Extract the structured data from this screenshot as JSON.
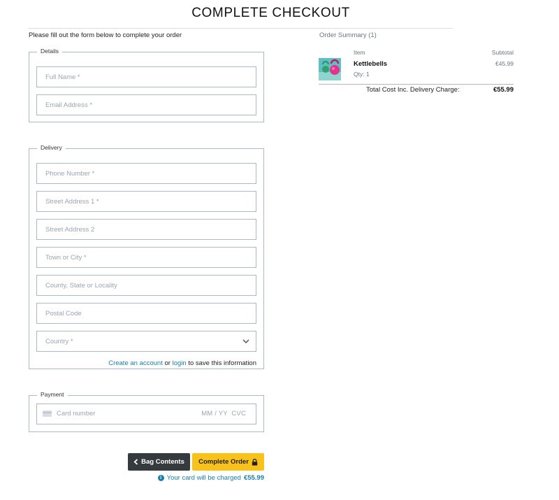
{
  "page": {
    "title": "COMPLETE CHECKOUT",
    "intro": "Please fill out the form below to complete your order"
  },
  "details": {
    "legend": "Details",
    "full_name_placeholder": "Full Name *",
    "email_placeholder": "Email Address *"
  },
  "delivery": {
    "legend": "Delivery",
    "phone_placeholder": "Phone Number *",
    "street1_placeholder": "Street Address 1 *",
    "street2_placeholder": "Street Address 2",
    "town_placeholder": "Town or City *",
    "county_placeholder": "County, State or Locality",
    "postal_placeholder": "Postal Code",
    "country_selected": "Country *",
    "save_note": {
      "create_account": "Create an account",
      "or": "or",
      "login": "login",
      "suffix": "to save this information"
    }
  },
  "payment": {
    "legend": "Payment",
    "card_number_placeholder": "Card number",
    "expiry_cvc_placeholder": "MM / YY  CVC"
  },
  "actions": {
    "back_label": "Bag Contents",
    "complete_label": "Complete Order",
    "charge_note": "Your card will be charged",
    "charge_amount": "€55.99"
  },
  "summary": {
    "title": "Order Summary (1)",
    "col_item": "Item",
    "col_subtotal": "Subtotal",
    "items": [
      {
        "name": "Kettlebells",
        "qty": "Qty: 1",
        "price": "€45.99"
      }
    ],
    "total_label": "Total Cost Inc. Delivery Charge:",
    "total_value": "€55.99"
  },
  "colors": {
    "accent_yellow": "#f8c21a",
    "dark_button": "#353a3f",
    "link_blue": "#1a7fa6",
    "field_border": "#a9b9c7"
  }
}
